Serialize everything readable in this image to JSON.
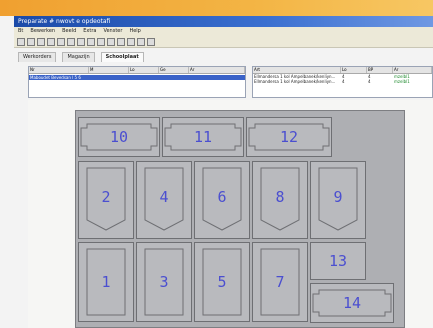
{
  "window": {
    "title": "Preparate #  nwovt e opdeotafi"
  },
  "menu": [
    "Bt",
    "Bewerken",
    "Beeld",
    "Extra",
    "Venster",
    "Help"
  ],
  "tabs": [
    {
      "label": "Werkorders",
      "active": false
    },
    {
      "label": "Magazijn",
      "active": false
    },
    {
      "label": "Schoolplaat",
      "active": true
    }
  ],
  "left_list": {
    "columns": [
      "Nr",
      "M",
      "Lo",
      "Ge",
      "Ar"
    ],
    "selected_row": "Maboudet Bevedsan l   5   6"
  },
  "right_list": {
    "columns": [
      "Art",
      "Lo",
      "BP",
      "Ar"
    ],
    "rows": [
      {
        "name": "Ellmandersa 1 kol Ampelbanek/kenliyn...",
        "a": "4",
        "b": "4",
        "status": "mzelbl1"
      },
      {
        "name": "Ellmandersa 1 kol Ampelbanek/kenliyn...",
        "a": "4",
        "b": "4",
        "status": "mzelbl1"
      }
    ]
  },
  "board": {
    "cells": [
      "10",
      "11",
      "12",
      "2",
      "4",
      "6",
      "8",
      "9",
      "1",
      "3",
      "5",
      "7",
      "13",
      "14"
    ]
  },
  "colors": {
    "accent": "#f0a030",
    "titlebar": "#1b4aa8",
    "label": "#4b4fd0",
    "board": "#aeafb3"
  }
}
